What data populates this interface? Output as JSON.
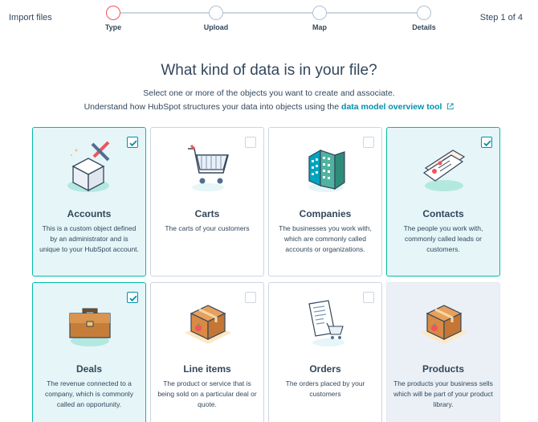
{
  "header": {
    "title": "Import files",
    "step_count": "Step 1 of 4",
    "steps": [
      {
        "label": "Type",
        "active": true
      },
      {
        "label": "Upload",
        "active": false
      },
      {
        "label": "Map",
        "active": false
      },
      {
        "label": "Details",
        "active": false
      }
    ]
  },
  "intro": {
    "headline": "What kind of data is in your file?",
    "subtext": "Select one or more of the objects you want to create and associate.",
    "help_prefix": "Understand how HubSpot structures your data into objects using the",
    "help_link": "data model overview tool"
  },
  "objects": [
    {
      "title": "Accounts",
      "description": "This is a custom object defined by an administrator and is unique to your HubSpot account.",
      "checked": true,
      "icon": "custom-object-cube-icon"
    },
    {
      "title": "Carts",
      "description": "The carts of your customers",
      "checked": false,
      "icon": "shopping-cart-icon"
    },
    {
      "title": "Companies",
      "description": "The businesses you work with, which are commonly called accounts or organizations.",
      "checked": false,
      "icon": "office-building-icon"
    },
    {
      "title": "Contacts",
      "description": "The people you work with, commonly called leads or customers.",
      "checked": true,
      "icon": "contact-cards-icon"
    },
    {
      "title": "Deals",
      "description": "The revenue connected to a company, which is commonly called an opportunity.",
      "checked": true,
      "icon": "briefcase-icon"
    },
    {
      "title": "Line items",
      "description": "The product or service that is being sold on a particular deal or quote.",
      "checked": false,
      "icon": "product-box-icon"
    },
    {
      "title": "Orders",
      "description": "The orders placed by your customers",
      "checked": false,
      "icon": "order-receipt-icon"
    },
    {
      "title": "Products",
      "description": "The products your business sells which will be part of your product library.",
      "checked": false,
      "disabled": true,
      "icon": "product-box-icon"
    }
  ],
  "colors": {
    "accent_teal": "#00bda5",
    "link": "#0091ae",
    "active_step": "#f2545b",
    "text": "#33475b"
  }
}
